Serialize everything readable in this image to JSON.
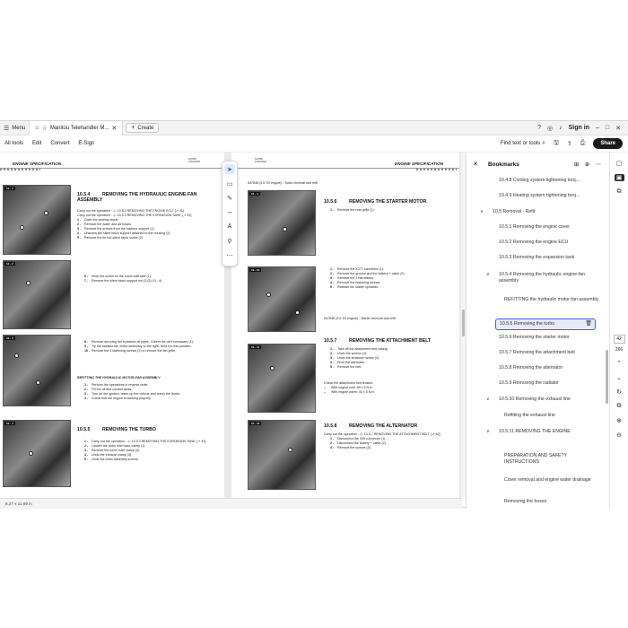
{
  "tabbar": {
    "menu_label": "Menu",
    "tab_title": "Manitou Telehandler M...",
    "create_label": "Create",
    "signin_label": "Sign in"
  },
  "toolbar": {
    "items": [
      "All tools",
      "Edit",
      "Convert",
      "E-Sign"
    ],
    "find_label": "Find text or tools",
    "share_label": "Share"
  },
  "status": {
    "dimensions": "8,27 x 11,69 in"
  },
  "left_page": {
    "header": "ENGINE SPECIFICATION",
    "code": "647868\n10/04/2020",
    "photo_tags": [
      "10 - 1",
      "10 - 2",
      "10 - 3",
      "10 - 4"
    ],
    "s1_num": "10.5.4",
    "s1_title": "REMOVING THE HYDRAULIC ENGINE-FAN ASSEMBLY",
    "s1_pre1": "Carry out the operation : -▷ 10.5.2 REMOVING THE ENGINE ECU, [↗ 41]",
    "s1_pre2": "Carry out the operation : -▷ 10.5.3 REMOVING THE EXPANSION TANK, [↗ 41]",
    "s1_steps": [
      "Drain the cooling circuit",
      "Remove the water and air hoses",
      "Remove the screws from the fusebox support (1).",
      "Unscrew the silent block support attached to the housing (2).",
      "Remove the tie rod silent block screw (3)."
    ],
    "s2_steps": [
      "Keep the screw on the boom wall side (1).",
      "Remove the silent block support nut (2,(3) 10 - 4)."
    ],
    "s3_steps": [
      "Remove and plug the hydraulic oil pipes. Collect the oil if necessary (1).",
      "Tip the radiator-fan motor assembly to the right. Hold it in this position.",
      "Remove the 4 fastening screws (2) to remove the fan grille."
    ],
    "refit_title": "REFITTING THE HYDRAULIC MOTOR-FAN ASSEMBLY",
    "refit_steps": [
      "Perform the operations in reverse order.",
      "Fill the oil and coolant tanks.",
      "Turn on the ignition, warm up the vehicle and check the levels.",
      "Check that the engine is working properly."
    ],
    "s4_num": "10.5.5",
    "s4_title": "REMOVING THE TURBO",
    "s4_steps": [
      "Carry out the operation : -▷ 10.5.3 REMOVING THE EXPANSION TANK, [↗ 41]",
      "Loosen the turbo inlet hose clamp (1).",
      "Remove the turbo hose clamp (2).",
      "Undo the exhaust clamp (3).",
      "Undo the turbo fastening screws."
    ]
  },
  "right_page": {
    "header": "ENGINE SPECIFICATION",
    "code": "647868\n10/04/2020",
    "top_caption": "647848 (3.6 TD engine) - Turbo removal and refit",
    "photo_tags": [
      "10 - 4",
      "10 - 10",
      "10 - 11",
      "10 - 12"
    ],
    "s1_num": "10.5.6",
    "s1_title": "REMOVING THE STARTER MOTOR",
    "s1_steps": [
      "Remove the rear grille (1)."
    ],
    "s2_steps": [
      "Remove the X277 connector (1).",
      "Remove the ground and the battery + cable (2).",
      "Remove the 2 harnesses.",
      "Remove the fastening screws.",
      "Release the starter upwards."
    ],
    "mid_caption": "647848 (3.6 TD engine) - Starter removal and refit",
    "s3_num": "10.5.7",
    "s3_title": "REMOVING THE ATTACHMENT BELT",
    "s3_steps": [
      "Take off the attachment belt casing.",
      "Undo the screws (1).",
      "Undo the tensioner screw (2).",
      "Pivot the alternator.",
      "Remove the belt."
    ],
    "tension_title": "Check the attachment belt tension.",
    "tension_lines": [
      "With engine cold: 65 ± 5 N.m",
      "With engine warm: 40 ± 5 N.m"
    ],
    "s4_num": "10.5.8",
    "s4_title": "REMOVING THE ALTERNATOR",
    "s4_pre": "Carry out the operation : -▷ 10.5.7 REMOVING THE ATTACHMENT BELT, [↗ 43]",
    "s4_steps": [
      "Disconnect the X39 connector (1).",
      "Disconnect the battery + cable (2).",
      "Remove the screws (3)."
    ]
  },
  "bookmarks": {
    "title": "Bookmarks",
    "items": [
      {
        "label": "10.4.8 Cooling system tightening torq...",
        "chev": ""
      },
      {
        "label": "10.4.9 Heating system tightening torq...",
        "chev": ""
      },
      {
        "label": "10.5 Removal - Refit",
        "chev": "∨"
      },
      {
        "label": "10.5.1 Removing the engine cover",
        "chev": ""
      },
      {
        "label": "10.5.2 Removing the engine ECU",
        "chev": ""
      },
      {
        "label": "10.5.3 Removing the expansion tank",
        "chev": ""
      },
      {
        "label": "10.5.4 Removing the hydraulic engine-fan assembly",
        "chev": "∨"
      },
      {
        "label": "REFITTING the hydraulic motor-fan assembly",
        "chev": ""
      },
      {
        "label": "10.5.5 Removing the turbo",
        "chev": ""
      },
      {
        "label": "10.5.6 Removing the starter motor",
        "chev": ""
      },
      {
        "label": "10.5.7 Removing the attachment belt",
        "chev": ""
      },
      {
        "label": "10.5.8 Removing the alternator",
        "chev": ""
      },
      {
        "label": "10.5.9 Removing the radiator",
        "chev": ""
      },
      {
        "label": "10.5.10 Removing the exhaust line",
        "chev": "∨"
      },
      {
        "label": "Refitting the exhaust line",
        "chev": ""
      },
      {
        "label": "10.5.11 REMOVING THE ENGINE",
        "chev": "∨"
      },
      {
        "label": "PREPARATION AND SAFETY INSTRUCTIONS",
        "chev": ""
      },
      {
        "label": "Cover removal and engine water drainage",
        "chev": ""
      },
      {
        "label": "Removing the hoses",
        "chev": ""
      }
    ]
  },
  "rail": {
    "page_current": "42",
    "page_total": "266"
  }
}
